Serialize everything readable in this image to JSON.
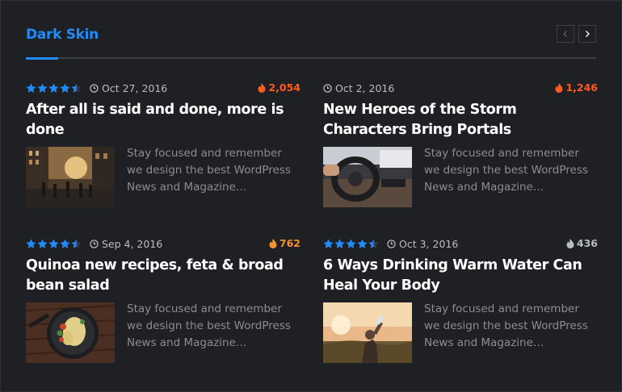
{
  "widget": {
    "title": "Dark Skin"
  },
  "colors": {
    "accent": "#1e8cff",
    "hot": "#ff5a1f",
    "warm": "#f6922d",
    "neutral": "#b8bcc4",
    "background": "#1f2024"
  },
  "nav": {
    "prev_icon": "chevron-left-icon",
    "next_icon": "chevron-right-icon"
  },
  "posts": [
    {
      "rating": 4.5,
      "date": "Oct 27, 2016",
      "views": "2,054",
      "views_color": "#ff5a1f",
      "title": "After all is said and done, more is done",
      "excerpt": "Stay focused and remember we design the best WordPress News and Magazine…",
      "thumbnail": "city-street-sunset"
    },
    {
      "date": "Oct 2, 2016",
      "views": "1,246",
      "views_color": "#ff5a1f",
      "title": "New Heroes of the Storm Characters Bring Portals",
      "excerpt": "Stay focused and remember we design the best WordPress News and Magazine…",
      "thumbnail": "car-steering-wheel"
    },
    {
      "rating": 4.5,
      "date": "Sep 4, 2016",
      "views": "762",
      "views_color": "#f6922d",
      "title": "Quinoa new recipes, feta & broad bean salad",
      "excerpt": "Stay focused and remember we design the best WordPress News and Magazine…",
      "thumbnail": "pan-of-food"
    },
    {
      "rating": 4.5,
      "date": "Oct 3, 2016",
      "views": "436",
      "views_color": "#b8bcc4",
      "title": "6 Ways Drinking Warm Water Can Heal Your Body",
      "excerpt": "Stay focused and remember we design the best WordPress News and Magazine…",
      "thumbnail": "man-drinking-water-sunset"
    }
  ]
}
